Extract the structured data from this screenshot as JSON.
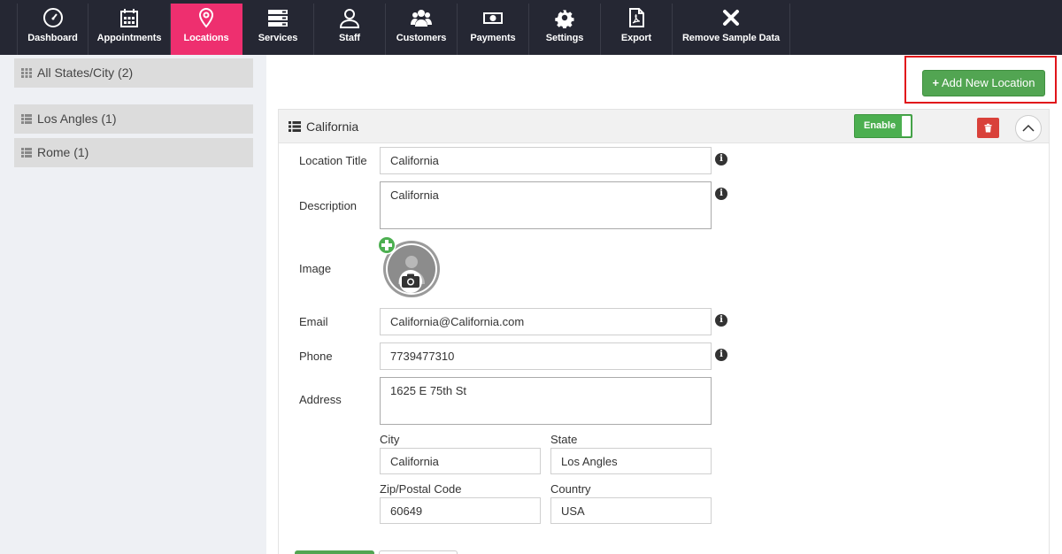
{
  "nav": {
    "items": [
      {
        "label": "Dashboard",
        "icon": "speedometer-icon"
      },
      {
        "label": "Appointments",
        "icon": "calendar-icon"
      },
      {
        "label": "Locations",
        "icon": "map-pin-icon"
      },
      {
        "label": "Services",
        "icon": "server-icon"
      },
      {
        "label": "Staff",
        "icon": "user-icon"
      },
      {
        "label": "Customers",
        "icon": "users-icon"
      },
      {
        "label": "Payments",
        "icon": "money-icon"
      },
      {
        "label": "Settings",
        "icon": "gear-icon"
      },
      {
        "label": "Export",
        "icon": "pdf-file-icon"
      },
      {
        "label": "Remove Sample Data",
        "icon": "close-icon"
      }
    ],
    "active": "Locations",
    "active_color": "#ee2f6f",
    "bg_color": "#252733"
  },
  "sidebar": {
    "all_label": "All States/City (2)",
    "items": [
      {
        "label": "Los Angles (1)"
      },
      {
        "label": "Rome (1)"
      }
    ]
  },
  "toolbar": {
    "add_label": "Add New Location",
    "add_color": "#52a552",
    "highlight_color": "#e1141b"
  },
  "location": {
    "title": "California",
    "toggle_label": "Enable",
    "fields": {
      "title_label": "Location Title",
      "title_value": "California",
      "description_label": "Description",
      "description_value": "California",
      "image_label": "Image",
      "email_label": "Email",
      "email_value": "California@California.com",
      "phone_label": "Phone",
      "phone_value": "7739477310",
      "address_label": "Address",
      "address_value": "1625 E 75th St",
      "city_label": "City",
      "city_value": "California",
      "state_label": "State",
      "state_value": "Los Angles",
      "zip_label": "Zip/Postal Code",
      "zip_value": "60649",
      "country_label": "Country",
      "country_value": "USA"
    }
  }
}
